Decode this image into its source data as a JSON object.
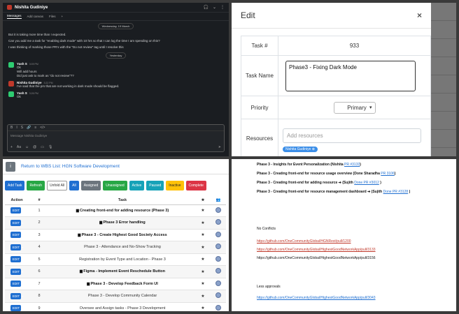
{
  "chat": {
    "contact_name": "Nishita Gudiniye",
    "tabs": [
      "Messages",
      "Add canvas",
      "Files"
    ],
    "day_sep_1": "Wednesday, 19 March",
    "day_sep_2": "Yesterday",
    "lines_top": [
      "But it is taking more time than I expected.",
      "Can you add me a task for \"enabling dark mode\" with 10 hrs so that I can log the time I am spending on this?",
      "I was thinking of marking those PR's with the \"Do not review\" tag until I resolve this"
    ],
    "messages": [
      {
        "who": "Yash S",
        "time": "3:09 PM",
        "lines": [
          "Ok",
          "Will add hours"
        ]
      },
      {
        "who": "",
        "time": "",
        "lines": [
          "Did just ask to mark as \"do not review\"??"
        ]
      },
      {
        "who": "Nishita Gudiniye",
        "time": "3:22 PM",
        "lines": [
          "I've said that the prs that are not working in dark mode should be flagged."
        ]
      },
      {
        "who": "Yash S",
        "time": "3:26 PM",
        "lines": [
          "Ok"
        ]
      }
    ],
    "composer_placeholder": "Message Nishita Gudiniye"
  },
  "edit_modal": {
    "title": "Edit",
    "close": "×",
    "task_no_label": "Task #",
    "task_no_value": "933",
    "task_name_label": "Task Name",
    "task_name_value": "Phase3 - Fixing Dark Mode",
    "priority_label": "Priority",
    "priority_value": "Primary",
    "resources_label": "Resources",
    "resources_placeholder": "Add resources",
    "resource_chip": "Nishita Gudiniye"
  },
  "task_list": {
    "return_link": "Return to WBS List: HGN Software Development",
    "filters": [
      {
        "label": "Add Task",
        "color": "#1f6fd1"
      },
      {
        "label": "Refresh",
        "color": "#28a745"
      },
      {
        "label": "Unfold All",
        "color": "#ffffff"
      },
      {
        "label": "All",
        "color": "#1f6fd1"
      },
      {
        "label": "Assigned",
        "color": "#6c757d"
      },
      {
        "label": "Unassigned",
        "color": "#28a745"
      },
      {
        "label": "Active",
        "color": "#17a2b8"
      },
      {
        "label": "Paused",
        "color": "#17a2b8"
      },
      {
        "label": "Inactive",
        "color": "#ffc107"
      },
      {
        "label": "Complete",
        "color": "#dc3545"
      }
    ],
    "headers": {
      "action": "Action",
      "num": "#",
      "task": "Task",
      "star": "★"
    },
    "edit_label": "EDIT",
    "rows": [
      {
        "num": "1",
        "task": "Creating front-end for adding resource (Phase 3)",
        "bold": true,
        "folder": true
      },
      {
        "num": "2",
        "task": "Phase 3 Error handling",
        "bold": true,
        "folder": true
      },
      {
        "num": "3",
        "task": "Phase 3 - Create Highest Good Society Access",
        "bold": true,
        "folder": true
      },
      {
        "num": "4",
        "task": "Phase 3 - Attendance and No-Show Tracking",
        "bold": false,
        "folder": false
      },
      {
        "num": "5",
        "task": "Registration by Event Type and Location - Phase 3",
        "bold": false,
        "folder": false
      },
      {
        "num": "6",
        "task": "Figma - Implement Event Reschedule Button",
        "bold": true,
        "folder": true
      },
      {
        "num": "7",
        "task": "Phase 3 - Develop Feedback Form UI",
        "bold": true,
        "folder": true
      },
      {
        "num": "8",
        "task": "Phase 3 - Develop Community Calendar",
        "bold": false,
        "folder": false
      },
      {
        "num": "9",
        "task": "Oversee and Assign tasks - Phase 3 Development",
        "bold": false,
        "folder": false
      }
    ]
  },
  "doc": {
    "items": [
      {
        "bold": "Phase 3 - Insights for Event Personalization (Nishita ",
        "pr": "PR #3133",
        "tail": ")"
      },
      {
        "bold": "Phase 3 - Creating front-end for resource usage overview (Done Sharadha ",
        "pr": "PR 3106",
        "tail": ")"
      },
      {
        "bold": "Phase 3 - Creating front-end for adding resource ➔ (Sujith ",
        "pr": "Done PR #3012",
        "tail": " )"
      },
      {
        "bold": "Phase 3 - Creating front-end for resource management dashboard ➔ (Sujith ",
        "pr": "Done PR #3128",
        "tail": " )"
      }
    ],
    "no_conflicts": "No Conflicts",
    "links": [
      "https://github.com/OneCommunityGlobal/HGNRest/pull/1200",
      "https://github.com/OneCommunityGlobal/HighestGoodNetworkApp/pull/3133",
      "https://github.com/OneCommunityGlobal/HighestGoodNetworkApp/pull/3156"
    ],
    "less_approvals": "Less approvals",
    "last_link": "https://github.com/OneCommunityGlobal/HighestGoodNetworkApp/pull/3043"
  }
}
